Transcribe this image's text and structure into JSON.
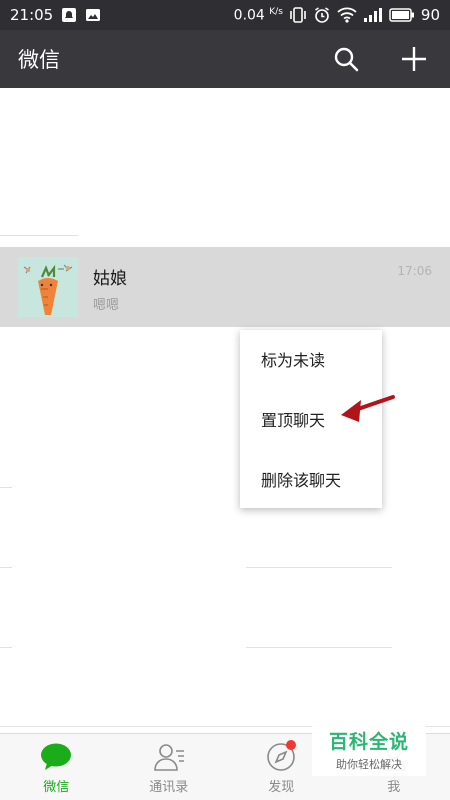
{
  "status_bar": {
    "time": "21:05",
    "net_speed": "0.04",
    "net_speed_unit": "K/s",
    "battery": "90",
    "icons": [
      "notification-icon",
      "image-icon",
      "vibrate-icon",
      "alarm-icon",
      "wifi-icon",
      "signal-icon",
      "battery-icon"
    ]
  },
  "app_bar": {
    "title": "微信",
    "icons": [
      "search-icon",
      "plus-icon"
    ]
  },
  "chat": {
    "name": "姑娘",
    "preview": "嗯嗯",
    "time": "17:06"
  },
  "context_menu": {
    "items": [
      {
        "label": "标为未读"
      },
      {
        "label": "置顶聊天"
      },
      {
        "label": "删除该聊天"
      }
    ]
  },
  "annotation": {
    "arrow_color": "#b3141c"
  },
  "bottom_nav": {
    "tabs": [
      {
        "label": "微信",
        "icon": "chat-bubble-icon",
        "active": true
      },
      {
        "label": "通讯录",
        "icon": "contacts-icon",
        "active": false
      },
      {
        "label": "发现",
        "icon": "compass-icon",
        "active": false,
        "badge": true
      },
      {
        "label": "我",
        "icon": "person-icon",
        "active": false
      }
    ]
  },
  "watermark": {
    "title": "百科全说",
    "subtitle": "助你轻松解决"
  },
  "colors": {
    "accent": "#1aad19",
    "header": "#38383d",
    "status_bar": "#2e2e33",
    "selected_row": "#d9d9d9",
    "badge": "#f43530",
    "watermark": "#2bb673"
  }
}
